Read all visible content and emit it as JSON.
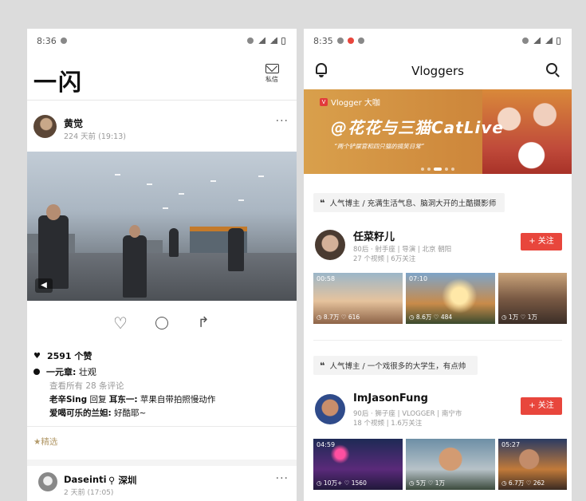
{
  "left": {
    "status": {
      "time": "8:36"
    },
    "app": {
      "logo": "一闪",
      "messages_label": "私信"
    },
    "post": {
      "author": "黄觉",
      "time": "224 天前 (19:13)",
      "likes": "2591 个赞",
      "caption_author": "一元章:",
      "caption_text": "壮观",
      "view_all_comments": "查看所有 28 条评论",
      "comments": [
        {
          "user": "老辛Sing",
          "reply_word": "回复",
          "reply_to": "耳东一:",
          "text": "苹果自带拍照慢动作"
        },
        {
          "user": "爱喝可乐的兰妲:",
          "text": "好酷耶~"
        }
      ],
      "featured_label": "★精选"
    },
    "post2": {
      "author": "Daseinti",
      "location": "深圳",
      "time": "2 天前 (17:05)"
    }
  },
  "right": {
    "status": {
      "time": "8:35"
    },
    "app": {
      "title": "Vloggers"
    },
    "banner": {
      "tag": "Vlogger 大咖",
      "headline": "@花花与三猫CatLive",
      "subtitle": "“两个铲屎官和四只猫的搞笑日常”"
    },
    "sections": [
      {
        "quote": "❝",
        "label": "人气博主 / 充满生活气息、脑洞大开的土酷摄影师",
        "vlogger": {
          "name": "任菜籽儿",
          "meta1": "80后 · 射手座 | 导演 | 北京 朝阳",
          "meta2": "27 个视频 | 6万关注",
          "follow": "+ 关注"
        },
        "videos": [
          {
            "duration": "00:58",
            "stats": "◷ 8.7万 ♡ 616"
          },
          {
            "duration": "07:10",
            "stats": "◷ 8.6万 ♡ 484"
          },
          {
            "duration": "",
            "stats": "◷ 1万 ♡ 1万"
          }
        ]
      },
      {
        "quote": "❝",
        "label": "人气博主 / 一个戏很多的大学生，有点帅",
        "vlogger": {
          "name": "ImJasonFung",
          "meta1": "90后 · 狮子座 | VLOGGER | 南宁市",
          "meta2": "18 个视频 | 1.6万关注",
          "follow": "+ 关注"
        },
        "videos": [
          {
            "duration": "04:59",
            "stats": "◷ 10万+ ♡ 1560"
          },
          {
            "duration": "",
            "stats": "◷ 5万 ♡ 1万"
          },
          {
            "duration": "05:27",
            "stats": "◷ 6.7万 ♡ 262"
          }
        ]
      }
    ]
  }
}
